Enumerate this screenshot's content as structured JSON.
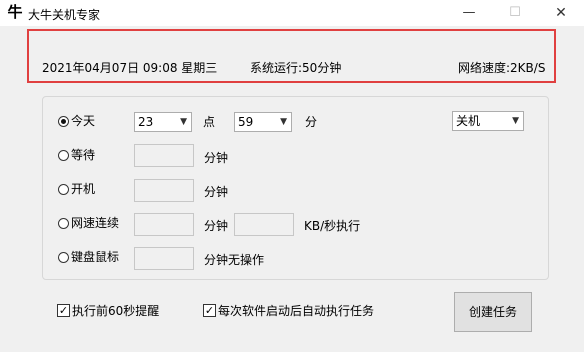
{
  "window": {
    "title": "大牛关机专家",
    "app_icon_glyph": "牛",
    "controls": {
      "minimize": "—",
      "maximize": "☐",
      "close": "✕"
    }
  },
  "info_bar": {
    "datetime": "2021年04月07日  09:08  星期三",
    "uptime": "系统运行:50分钟",
    "network_speed": "网络速度:2KB/S",
    "border_color": "#e04040"
  },
  "modes": {
    "today": {
      "label": "今天",
      "checked": true,
      "hour": "23",
      "hour_unit": "点",
      "minute": "59",
      "minute_unit": "分",
      "action": "关机"
    },
    "wait": {
      "label": "等待",
      "checked": false,
      "unit": "分钟"
    },
    "boot": {
      "label": "开机",
      "checked": false,
      "unit": "分钟"
    },
    "netspeed": {
      "label": "网速连续",
      "checked": false,
      "unit": "分钟",
      "speed_unit": "KB/秒执行"
    },
    "idle": {
      "label": "键盘鼠标",
      "checked": false,
      "unit": "分钟无操作"
    }
  },
  "options": {
    "remind": {
      "label": "执行前60秒提醒",
      "checked": true
    },
    "autorun": {
      "label": "每次软件启动后自动执行任务",
      "checked": true
    }
  },
  "create_button": "创建任务",
  "icons": {
    "dropdown": "chevron-down-icon",
    "check": "✓"
  }
}
